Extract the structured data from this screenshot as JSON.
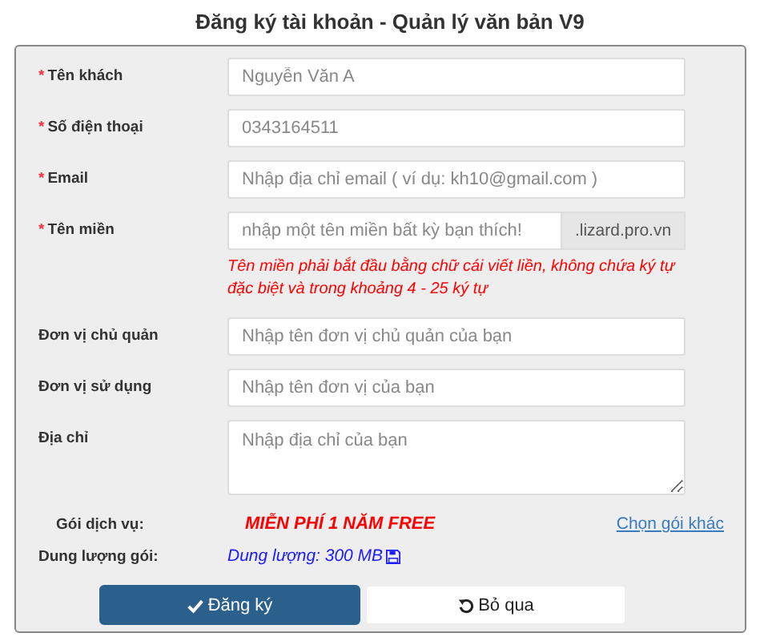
{
  "title": "Đăng ký tài khoản - Quản lý văn bản V9",
  "fields": [
    {
      "kind": "input",
      "label": "Tên khách",
      "required": "*",
      "placeholder": "Nguyễn Văn A"
    },
    {
      "kind": "input",
      "label": "Số điện thoại",
      "required": "*",
      "placeholder": "0343164511"
    },
    {
      "kind": "input",
      "label": "Email",
      "required": "*",
      "placeholder": "Nhập địa chỉ email ( ví dụ: kh10@gmail.com )"
    },
    {
      "kind": "addon",
      "label": "Tên miền",
      "required": "*",
      "placeholder": "nhập một tên miền bất kỳ bạn thích!",
      "addon": ".lizard.pro.vn",
      "error": "Tên miền phải bắt đầu bằng chữ cái viết liền, không chứa ký tự đặc biệt và trong khoảng 4 - 25 ký tự"
    },
    {
      "kind": "input",
      "label": "Đơn vị chủ quản",
      "placeholder": "Nhập tên đơn vị chủ quản của bạn"
    },
    {
      "kind": "input",
      "label": "Đơn vị sử dụng",
      "placeholder": "Nhập tên đơn vị của bạn"
    },
    {
      "kind": "textarea",
      "label": "Địa chỉ",
      "placeholder": "Nhập địa chỉ của bạn"
    }
  ],
  "package": {
    "label": "Gói dịch vụ:",
    "value": "MIỄN PHÍ 1 NĂM FREE",
    "link": "Chọn gói khác"
  },
  "storage": {
    "label": "Dung lượng gói:",
    "value": "Dung lượng: 300 MB"
  },
  "buttons": [
    {
      "kind": "primary",
      "label": "Đăng ký"
    },
    {
      "kind": "reset",
      "label": "Bỏ qua"
    }
  ]
}
